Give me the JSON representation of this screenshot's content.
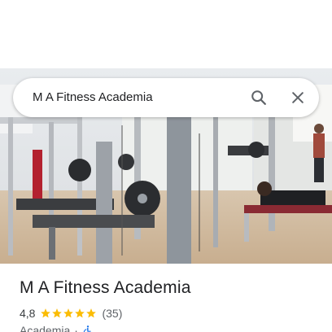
{
  "search": {
    "query": "M A Fitness Academia",
    "search_icon": "search-icon",
    "close_icon": "close-icon"
  },
  "hero": {
    "image": "gym-interior-photo"
  },
  "place": {
    "title": "M A Fitness Academia",
    "rating": "4,8",
    "stars_filled": 5,
    "stars_total": 5,
    "review_count": "(35)",
    "category": "Academia",
    "separator": "·",
    "accessibility_icon": "wheelchair-icon"
  },
  "colors": {
    "star": "#fbbc04",
    "text_primary": "#202124",
    "text_secondary": "#5f6368",
    "accessibility": "#1a73e8"
  }
}
